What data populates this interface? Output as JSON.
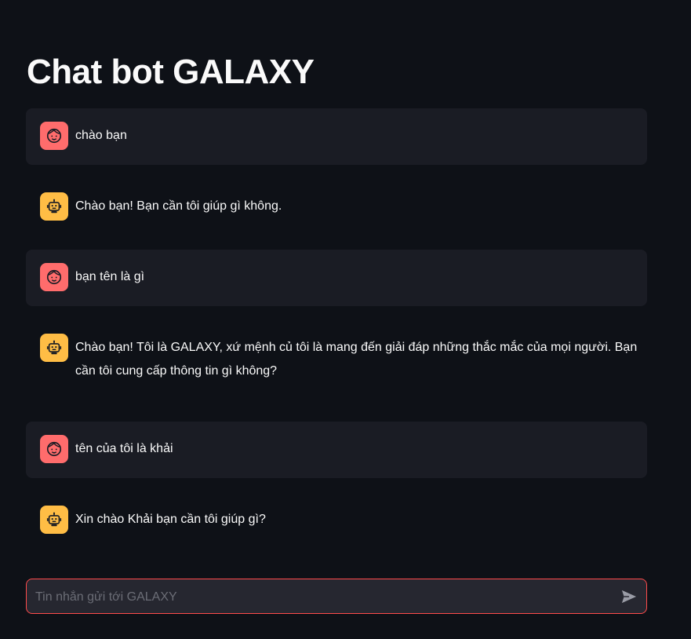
{
  "page": {
    "title": "Chat bot GALAXY"
  },
  "messages": [
    {
      "role": "user",
      "text": "chào bạn"
    },
    {
      "role": "assistant",
      "text": "Chào bạn! Bạn cần tôi giúp gì không."
    },
    {
      "role": "user",
      "text": "bạn tên là gì"
    },
    {
      "role": "assistant",
      "text": "Chào bạn! Tôi là GALAXY, xứ mệnh củ tôi là mang đến giải đáp những thắc mắc của mọi người. Bạn cần tôi cung cấp thông tin gì không?"
    },
    {
      "role": "user",
      "text": "tên của tôi là khải"
    },
    {
      "role": "assistant",
      "text": "Xin chào Khải bạn cần tôi giúp gì?"
    }
  ],
  "chat_input": {
    "placeholder": "Tin nhắn gửi tới GALAXY",
    "value": ""
  },
  "icons": {
    "user_avatar": "user-face-icon",
    "bot_avatar": "robot-icon",
    "send": "send-arrow-icon"
  },
  "colors": {
    "background": "#0e1117",
    "user_message_bg": "#1a1c24",
    "user_avatar": "#ff6c6c",
    "bot_avatar": "#ffbd45",
    "input_border": "#ff4b4b",
    "input_bg": "#262730"
  }
}
